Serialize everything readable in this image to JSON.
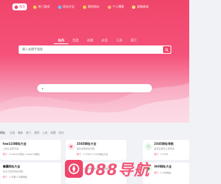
{
  "nav": {
    "items": [
      {
        "label": "首页",
        "icon": "home-icon",
        "color": "#f0456a"
      },
      {
        "label": "热门游戏",
        "icon": "fire-icon",
        "color": "#ffc94a"
      },
      {
        "label": "网址大全",
        "icon": "globe-icon",
        "color": "#6fc3ff"
      },
      {
        "label": "我的网站",
        "icon": "star-icon",
        "color": "#ffd34a"
      },
      {
        "label": "个人博客",
        "icon": "user-icon",
        "color": "#ffb07a"
      },
      {
        "label": "投稿收录",
        "icon": "edit-icon",
        "color": "#ffe07a"
      }
    ]
  },
  "search": {
    "tabs": [
      "站内",
      "百度",
      "谷歌",
      "必应",
      "工具",
      "其它"
    ],
    "active_tab": 0,
    "placeholder": "输入关键字搜索"
  },
  "pill": {
    "label": "+"
  },
  "breadcrumb": {
    "lead": "网址",
    "items": [
      "全部",
      "最新",
      "热门",
      "推荐",
      "工具",
      "收藏",
      "排名"
    ]
  },
  "cards": [
    {
      "title": "hao123网址大全",
      "sub": "上网从这里开始",
      "tags": [
        "热门",
        "5 hao123网址",
        "5 hao123网址"
      ]
    },
    {
      "title": "2345网址大全",
      "sub": "最实用的网址导航",
      "tags": [
        "热门",
        "5 2345",
        "5 2345网址大全"
      ]
    },
    {
      "title": "2345网址导航",
      "sub": "高效实用的上网导航",
      "tags": [
        "热门",
        "5 2345",
        "5 2345网址导航"
      ]
    },
    {
      "title": "毒霸网址大全",
      "sub": "安全可靠的网址导航",
      "tags": [
        "热门",
        "5 毒霸",
        "5 毒霸网址"
      ]
    },
    {
      "title": "",
      "sub": "",
      "tags": [
        "热门",
        "5 搜狗网址大全",
        "5 搜狗网址"
      ]
    },
    {
      "title": "360网址大全",
      "sub": "",
      "tags": [
        "热门",
        "5 360网址",
        "5 360导航"
      ]
    }
  ],
  "watermark": {
    "text": "088导航"
  },
  "colors": {
    "brand": "#f0456a"
  }
}
